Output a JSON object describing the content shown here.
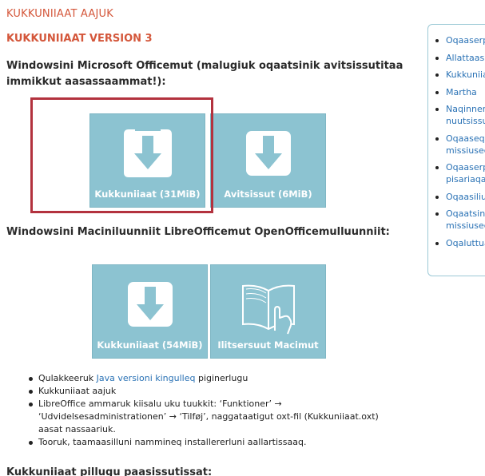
{
  "page": {
    "title": "KUKKUNIIAAT AAJUK",
    "section_title": "KUKKUNIIAAT VERSION 3",
    "windows_heading": "Windowsini Microsoft Officemut (malugiuk oqaatsinik avitsissutitaa immikkut aasassaammat!):",
    "mac_heading": "Windowsini Maciniluunniit LibreOfficemut OpenOfficemulluunniit:",
    "bottom_heading": "Kukkuniiaat pillugu paasissutissat:"
  },
  "downloads": {
    "win_main_label": "Kukkuniiaat (31MiB)",
    "win_split_label": "Avitsissut (6MiB)",
    "mac_main_label": "Kukkuniiaat (54MiB)",
    "mac_guide_label": "Ilitsersuut Macimut"
  },
  "requirements": {
    "item1_pre": "Qulakkeeruk ",
    "item1_link": "Java versioni kingulleq",
    "item1_post": " piginerlugu",
    "item2": "Kukkuniiaat aajuk",
    "item3": "LibreOffice ammaruk kiisalu uku tuukkit: ‘Funktioner’ → ‘Udvidelsesadministrationen’ → ‘Tilføj’, naggataatigut oxt-fil (Kukkuniiaat.oxt) aasat nassaariuk.",
    "item4": "Tooruk, taamaasilluni nammineq installererluni aallartissaaq."
  },
  "sidebar": {
    "links": [
      "Oqaaserpassuit",
      "Allattaasit",
      "Kukkuniiaat",
      "Martha",
      "Naqinnerit nuutsissut",
      "Oqaaseqatigiit missiuseqarfiat",
      "Oqaaserpassuit pisariaqartut",
      "Oqaasiliut",
      "Oqaatsinik missiuseqarfik",
      "Oqaluttuarisi"
    ]
  },
  "colors": {
    "accent": "#d4573b",
    "button_bg": "#8cc3d1",
    "link": "#2a72b5",
    "highlight": "#b3323e"
  },
  "icons": {
    "download": "download-arrow-icon",
    "guide": "open-book-hand-icon"
  }
}
